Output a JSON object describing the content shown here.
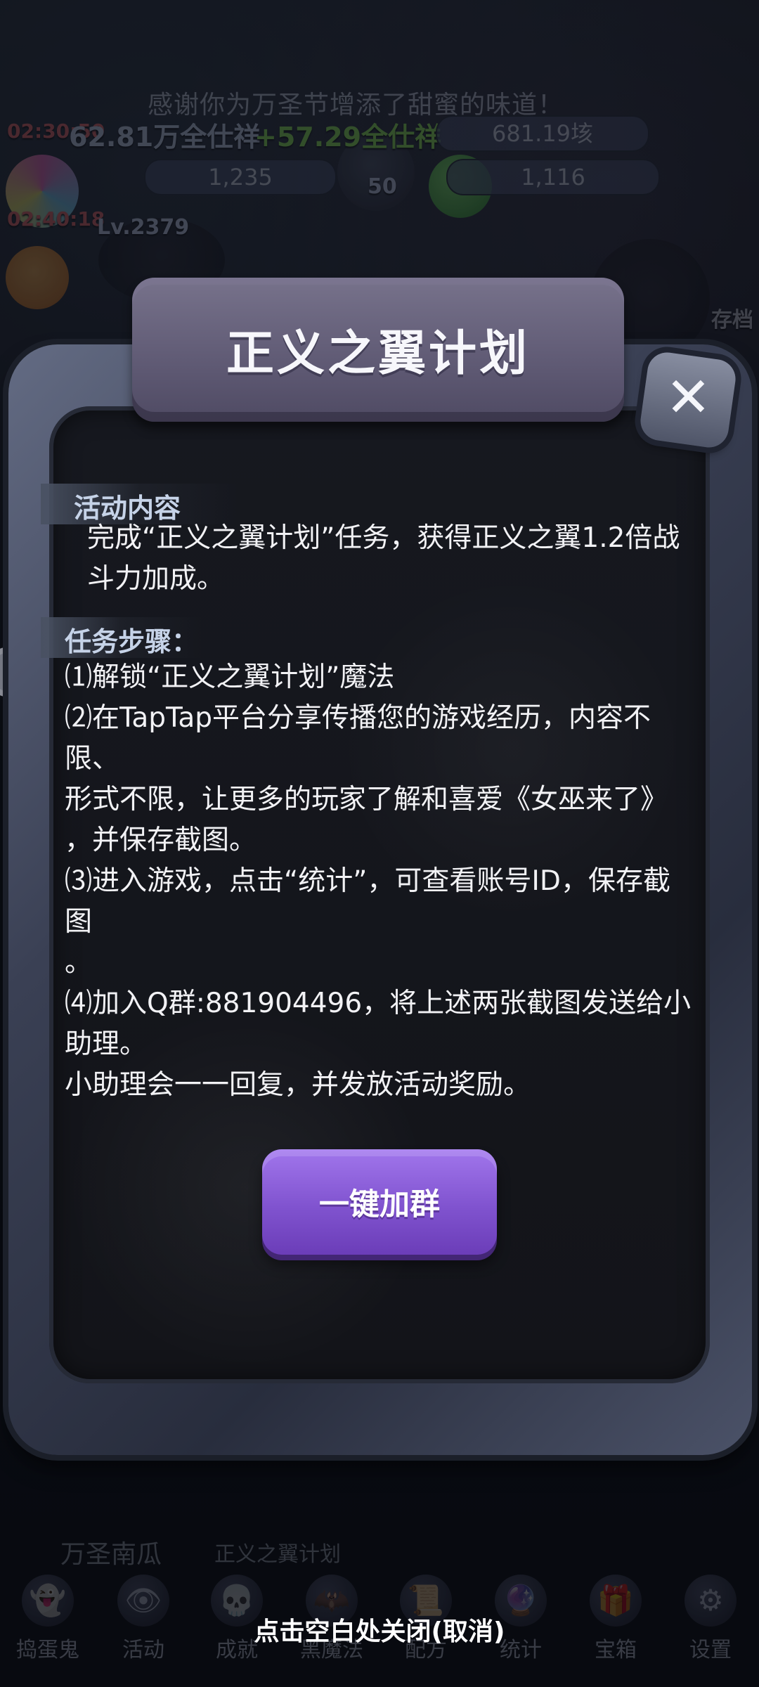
{
  "background": {
    "banner_text": "感谢你为万圣节增添了甜蜜的味道！",
    "timer_text": "02:30:50",
    "timer_text2": "02:40:18",
    "currency_left": "62.81万全仕祥",
    "currency_gain": "+57.29全仕祥",
    "currency_right": "681.19垓",
    "stat_left": "1,235",
    "stat_center": "50",
    "stat_right": "1,116",
    "level_text": "Lv.2379",
    "save_text": "存档",
    "pumpkin_label": "万圣南瓜",
    "wing_plan_label": "正义之翼计划"
  },
  "modal": {
    "title": "正义之翼计划",
    "activity_heading": "活动内容",
    "activity_line1": "完成“正义之翼计划”任务，获得正义之翼1.2倍战",
    "activity_line2": "斗力加成。",
    "steps_heading": "任务步骤：",
    "steps": [
      "⑴解锁“正义之翼计划”魔法",
      "⑵在TapTap平台分享传播您的游戏经历，内容不限、",
      "形式不限，让更多的玩家了解和喜爱《女巫来了》",
      "，并保存截图。",
      "⑶进入游戏，点击“统计”，可查看账号ID，保存截图",
      "。",
      "⑷加入Q群:881904496，将上述两张截图发送给小助理。",
      "小助理会一一回复，并发放活动奖励。"
    ],
    "join_button_label": "一键加群"
  },
  "footer": {
    "close_hint": "点击空白处关闭(取消)"
  },
  "bottom_nav": [
    {
      "label": "捣蛋鬼",
      "icon": "ghost-icon",
      "glyph": "👻"
    },
    {
      "label": "活动",
      "icon": "eyeballs-icon",
      "glyph": "👁"
    },
    {
      "label": "成就",
      "icon": "skull-icon",
      "glyph": "💀"
    },
    {
      "label": "黑魔法",
      "icon": "dark-magic-icon",
      "glyph": "🦇"
    },
    {
      "label": "配方",
      "icon": "recipe-icon",
      "glyph": "📜"
    },
    {
      "label": "统计",
      "icon": "crystal-ball-icon",
      "glyph": "🔮"
    },
    {
      "label": "宝箱",
      "icon": "treasure-chest-icon",
      "glyph": "🎁"
    },
    {
      "label": "设置",
      "icon": "gear-icon",
      "glyph": "⚙"
    }
  ],
  "colors": {
    "accent_purple": "#8053cf",
    "panel_dark": "#131419",
    "title_board": "#6d6883"
  }
}
